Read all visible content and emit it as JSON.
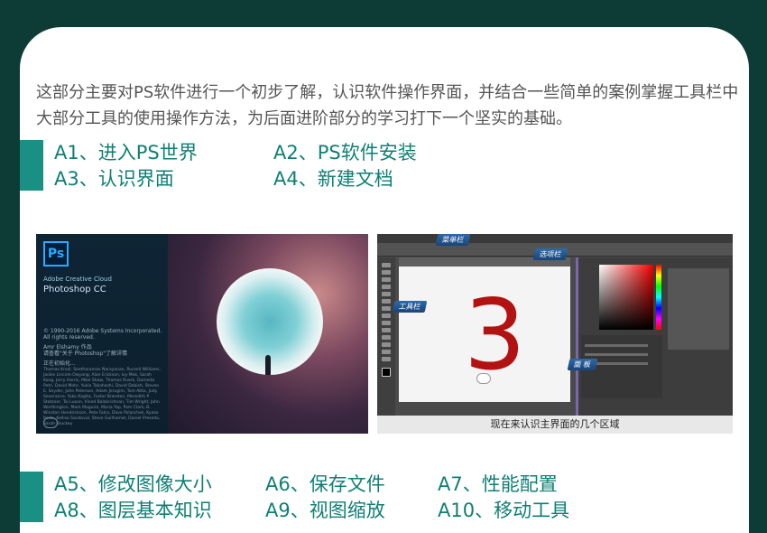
{
  "intro": "这部分主要对PS软件进行一个初步了解，认识软件操作界面，并结合一些简单的案例掌握工具栏中大部分工具的使用操作方法，为后面进阶部分的学习打下一个坚实的基础。",
  "lessons_top": [
    "A1、进入PS世界",
    "A2、PS软件安装",
    "A3、认识界面",
    "A4、新建文档"
  ],
  "lessons_bottom": [
    "A5、修改图像大小",
    "A6、保存文件",
    "A7、性能配置",
    "A8、图层基本知识",
    "A9、视图缩放",
    "A10、移动工具"
  ],
  "splash": {
    "logo": "Ps",
    "brand": "Adobe Creative Cloud",
    "product": "Photoshop CC",
    "copyright": "© 1990-2016 Adobe Systems Incorporated.",
    "rights": "All rights reserved.",
    "artist": "Amr Elshamy 作品",
    "artist_note": "请查看\"关于 Photoshop\"了解详情",
    "loading": "正在初始化...",
    "credits": "Thomas Knoll, Seetharaman Narayanan, Russell Williams, Jackie Lincoln-Owyang, Alan Erickson, Ivy Mak, Sarah Kong, Jerry Harris, Mike Shaw, Thomas Ruark, Domnita Petri, David Mohr, Yukie Takahashi, David Dobish, Steven E. Snyder, John Peterson, Adam Jerugim, Tom Attix, Judy Severance, Yuko Kagita, Foster Brereton, Meredith P. Stotzner, Tai Luxon, Vinod Balakrishnan, Tim Wright, John Worthington, Mark Maguire, Maria Yap, Pam Clark, B. Winston Hendrickson, Pete Falco, Dave Polaschek, Kyoko Itoda, Kellisa Sandoval, Steve Guilhamet, Daniel Presedo, Sarah Stuckey"
  },
  "ui": {
    "canvas_text": "3",
    "callouts": {
      "menubar": "菜单栏",
      "options": "选项栏",
      "tools": "工具栏",
      "panels": "面 板"
    },
    "caption": "现在来认识主界面的几个区域"
  }
}
